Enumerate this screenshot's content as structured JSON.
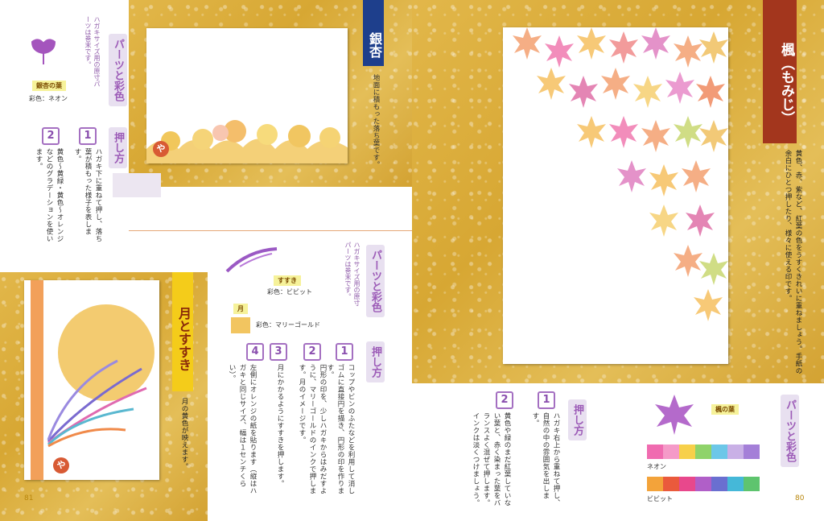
{
  "left_page": {
    "ginkgo": {
      "title": "銀杏",
      "description": "地面に積もった落ち葉です。",
      "parts_heading": "パーツと彩色",
      "parts_note": "ハガキサイズ用の原寸パーツは巻末です。",
      "leaf_label": "銀杏の葉",
      "leaf_color": "彩色：ネオン",
      "method_heading": "押し方",
      "steps": [
        {
          "num": "1",
          "text": "ハガキ下に重ねて押し、落ち葉が積もった様子を表します。"
        },
        {
          "num": "2",
          "text": "黄色～黄緑・黄色～オレンジなどのグラデーションを使います。"
        }
      ]
    },
    "moon": {
      "title": "月とすすき",
      "description": "月の黄色が映えます。",
      "parts_heading": "パーツと彩色",
      "parts_note": "ハガキサイズ用の原寸パーツは巻末です。",
      "susuki_label": "すすき",
      "susuki_color": "彩色：ビビット",
      "moon_label": "月",
      "moon_color": "彩色：マリーゴールド",
      "method_heading": "押し方",
      "steps": [
        {
          "num": "1",
          "text": "コップやビンのふたなどを利用して消しゴムに直接円を描き、円形の印を作ります。"
        },
        {
          "num": "2",
          "text": "円形の印を、少しハガキからはみだすように、マリーゴールドのインクで押します。月のイメージです。"
        },
        {
          "num": "3",
          "text": "月にかかるようにすすきを押します。"
        },
        {
          "num": "4",
          "text": "左側にオレンジの紙を貼ります（縦はハガキと同じサイズ、幅は１センチくらい）。"
        }
      ]
    },
    "stamp_char": "や",
    "page_number": "81"
  },
  "right_page": {
    "title": "楓（もみじ）",
    "description": "黄色、赤、紫など、紅葉の色をうすくきれいに重ねましょう。手紙の余白にひとつ押したり、様々に使える印です。",
    "parts_heading": "パーツと彩色",
    "leaf_label": "楓の葉",
    "method_heading": "押し方",
    "steps": [
      {
        "num": "1",
        "text": "ハガキ右上から重ねて押し、自然の中の雰囲気を出します。"
      },
      {
        "num": "2",
        "text": "黄色や緑のまだ紅葉していない葉と、赤く染まった葉をバランスよく混ぜて押します。インクは淡くつけましょう。"
      }
    ],
    "palettes": [
      {
        "name": "ネオン",
        "colors": [
          "#f06bb0",
          "#f59ac8",
          "#f7d04a",
          "#8fd36a",
          "#6cc7e8",
          "#c9b0e6",
          "#a47fd8"
        ]
      },
      {
        "name": "ビビット",
        "colors": [
          "#f3a33a",
          "#ea5a3c",
          "#e8488c",
          "#b05fc8",
          "#6a6fd0",
          "#45b8d8",
          "#5ec46e"
        ]
      }
    ],
    "page_number": "80"
  },
  "colors": {
    "accent_purple": "#9c5bb7",
    "ginkgo_banner": "#1e3f8c",
    "moon_banner": "#f4cc1a",
    "momiji_banner": "#a3361d",
    "marigold": "#f2c560"
  }
}
